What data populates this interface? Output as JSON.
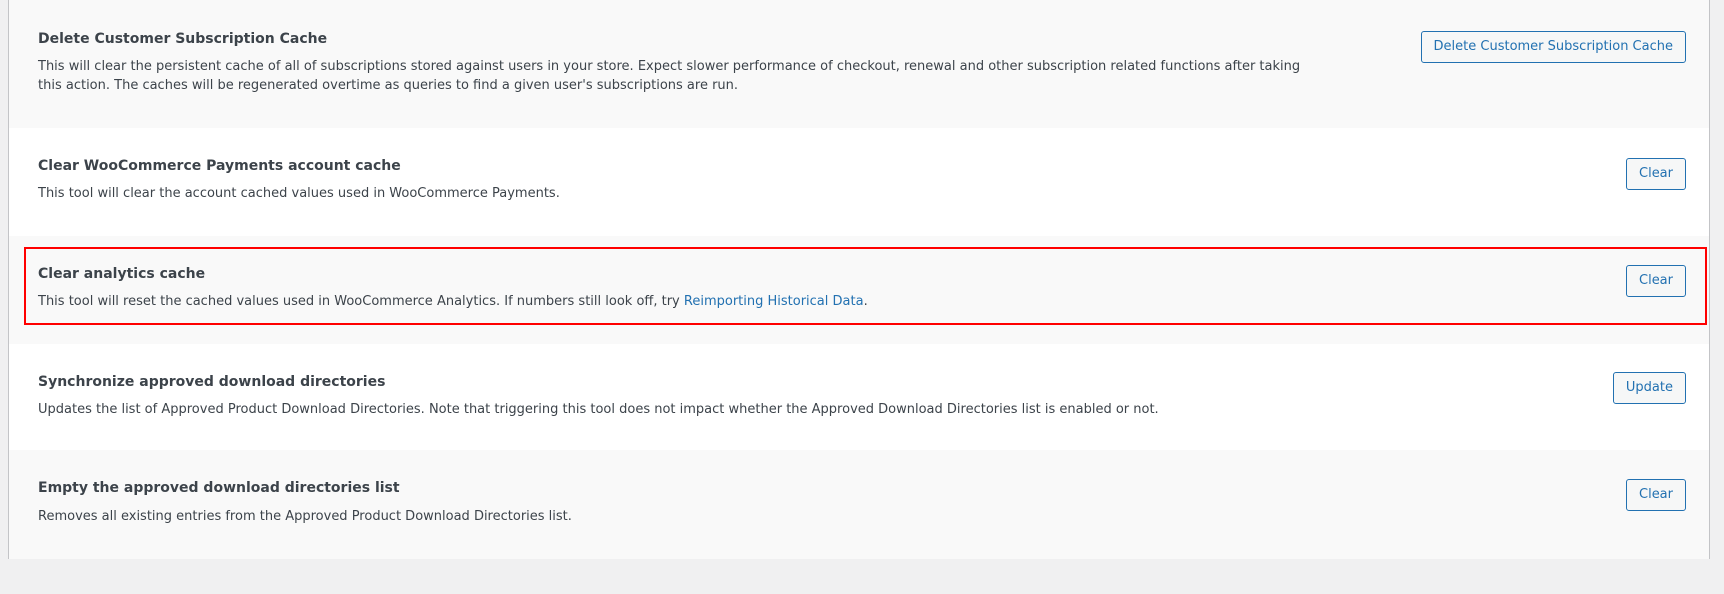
{
  "tools": [
    {
      "id": "delete-subscription-cache",
      "title": "Delete Customer Subscription Cache",
      "description": "This will clear the persistent cache of all of subscriptions stored against users in your store. Expect slower performance of checkout, renewal and other subscription related functions after taking this action. The caches will be regenerated overtime as queries to find a given user's subscriptions are run.",
      "button_label": "Delete Customer Subscription Cache"
    },
    {
      "id": "clear-wcpay-account-cache",
      "title": "Clear WooCommerce Payments account cache",
      "description": "This tool will clear the account cached values used in WooCommerce Payments.",
      "button_label": "Clear"
    },
    {
      "id": "clear-analytics-cache",
      "title": "Clear analytics cache",
      "description_prefix": "This tool will reset the cached values used in WooCommerce Analytics. If numbers still look off, try ",
      "link_text": "Reimporting Historical Data",
      "description_suffix": ".",
      "button_label": "Clear"
    },
    {
      "id": "sync-approved-download-dirs",
      "title": "Synchronize approved download directories",
      "description": "Updates the list of Approved Product Download Directories. Note that triggering this tool does not impact whether the Approved Download Directories list is enabled or not.",
      "button_label": "Update"
    },
    {
      "id": "empty-approved-download-dirs",
      "title": "Empty the approved download directories list",
      "description": "Removes all existing entries from the Approved Product Download Directories list.",
      "button_label": "Clear"
    }
  ],
  "colors": {
    "link": "#2271b1",
    "highlight": "#ff0000",
    "row_alt": "#f9f9f9"
  }
}
